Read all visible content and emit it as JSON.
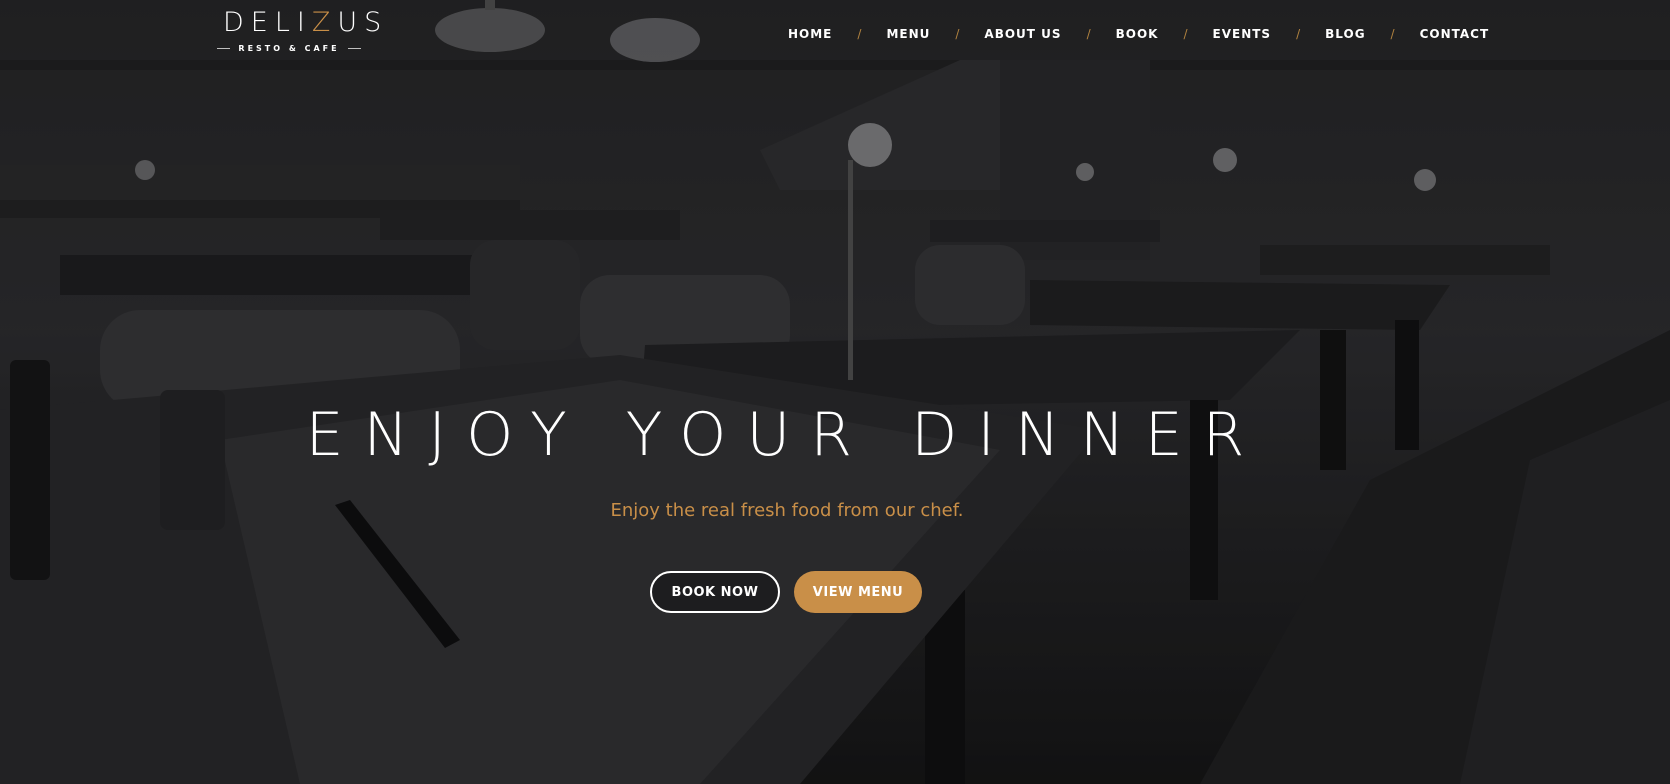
{
  "brand": {
    "name_part1": "DELI",
    "name_accent": "Z",
    "name_part2": "US",
    "subtitle": "RESTO & CAFE",
    "accent_color": "#c98f48"
  },
  "nav": {
    "items": [
      {
        "label": "HOME"
      },
      {
        "label": "MENU"
      },
      {
        "label": "ABOUT US"
      },
      {
        "label": "BOOK"
      },
      {
        "label": "EVENTS"
      },
      {
        "label": "BLOG"
      },
      {
        "label": "CONTACT"
      }
    ],
    "separator": "/"
  },
  "hero": {
    "headline": "ENJOY YOUR DINNER",
    "tagline": "Enjoy the real fresh food from our chef.",
    "primary_button": "BOOK NOW",
    "secondary_button": "VIEW MENU",
    "background": "dark restaurant dining room photo"
  }
}
